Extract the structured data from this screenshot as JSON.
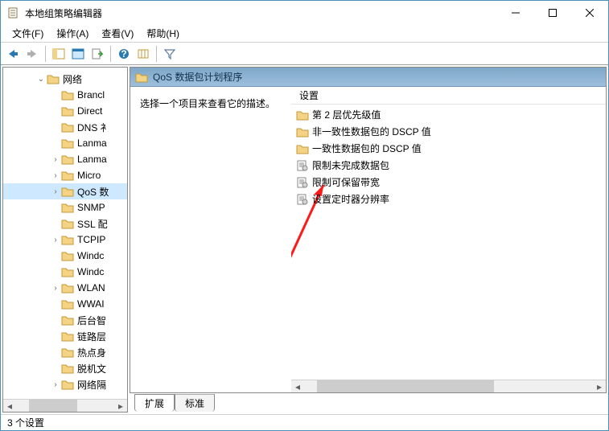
{
  "window": {
    "title": "本地组策略编辑器"
  },
  "menu": {
    "file": "文件(F)",
    "action": "操作(A)",
    "view": "查看(V)",
    "help": "帮助(H)"
  },
  "tree": {
    "root": "网络",
    "items": [
      {
        "label": "Brancl",
        "exp": ""
      },
      {
        "label": "Direct",
        "exp": ""
      },
      {
        "label": "DNS 衤",
        "exp": ""
      },
      {
        "label": "Lanma",
        "exp": ""
      },
      {
        "label": "Lanma",
        "exp": ">"
      },
      {
        "label": "Micro",
        "exp": ">"
      },
      {
        "label": "QoS 数",
        "exp": ">",
        "selected": true
      },
      {
        "label": "SNMP",
        "exp": ""
      },
      {
        "label": "SSL 配",
        "exp": ""
      },
      {
        "label": "TCPIP",
        "exp": ">"
      },
      {
        "label": "Windc",
        "exp": ""
      },
      {
        "label": "Windc",
        "exp": ""
      },
      {
        "label": "WLAN",
        "exp": ">"
      },
      {
        "label": "WWAI",
        "exp": ""
      },
      {
        "label": "后台智",
        "exp": ""
      },
      {
        "label": "链路层",
        "exp": ""
      },
      {
        "label": "热点身",
        "exp": ""
      },
      {
        "label": "脱机文",
        "exp": ""
      },
      {
        "label": "网络隔",
        "exp": ">"
      }
    ]
  },
  "content": {
    "header": "QoS 数据包计划程序",
    "description": "选择一个项目来查看它的描述。",
    "column_header": "设置",
    "items": [
      {
        "label": "第 2 层优先级值",
        "type": "folder"
      },
      {
        "label": "非一致性数据包的 DSCP 值",
        "type": "folder"
      },
      {
        "label": "一致性数据包的 DSCP 值",
        "type": "folder"
      },
      {
        "label": "限制未完成数据包",
        "type": "setting"
      },
      {
        "label": "限制可保留带宽",
        "type": "setting"
      },
      {
        "label": "设置定时器分辨率",
        "type": "setting"
      }
    ]
  },
  "tabs": {
    "extended": "扩展",
    "standard": "标准"
  },
  "status": "3 个设置"
}
